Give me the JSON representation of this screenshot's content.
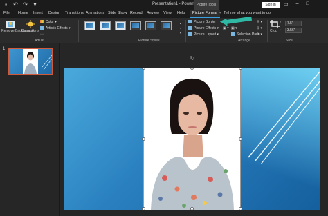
{
  "titlebar": {
    "title": "Presentation1 - PowerPoint",
    "context_tools": "Picture Tools",
    "signin_label": "Sign in"
  },
  "tabs": [
    "File",
    "Home",
    "Insert",
    "Design",
    "Transitions",
    "Animations",
    "Slide Show",
    "Record",
    "Review",
    "View",
    "Help",
    "Picture Format"
  ],
  "tell_me": "Tell me what you want to do",
  "ribbon": {
    "remove_background": "Remove Background",
    "corrections": "Corrections",
    "color": "Color",
    "artistic_effects": "Artistic Effects",
    "adjust_label": "Adjust",
    "picture_styles_label": "Picture Styles",
    "picture_border": "Picture Border",
    "picture_effects": "Picture Effects",
    "picture_layout": "Picture Layout",
    "selection_pane": "Selection Pane",
    "arrange_label": "Arrange",
    "crop": "Crop",
    "height_value": "7.5\"",
    "width_value": "3.56\"",
    "size_label": "Size"
  },
  "slides_pane": {
    "slide_number": "1"
  },
  "colors": {
    "accent_tab": "#3aa0e0",
    "callout_arrow": "#2fb8a4",
    "thumb_selection": "#d05a3c",
    "slide_light": "#4aa9dc",
    "slide_dark": "#155f9e"
  },
  "icons": [
    "undo-icon",
    "redo-icon",
    "save-icon",
    "lightbulb-icon",
    "rotate-handle-icon",
    "crop-icon"
  ]
}
